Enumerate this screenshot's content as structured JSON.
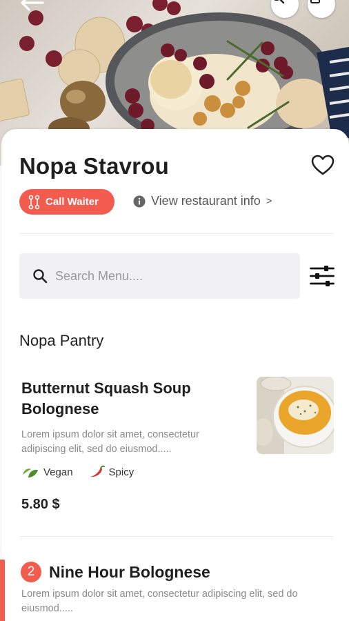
{
  "hero": {
    "image": "food-platter-photo",
    "back_icon": "arrow-left-icon",
    "search_icon": "search-icon",
    "profile_icon": "chef-hat-icon"
  },
  "restaurant": {
    "name": "Nopa Stavrou",
    "favorite_icon": "heart-outline-icon",
    "call_waiter_label": "Call Waiter",
    "info_link_label": "View restaurant info",
    "info_link_chevron": ">"
  },
  "search": {
    "placeholder": "Search Menu....",
    "value": ""
  },
  "menu": {
    "section_title": "Nopa Pantry",
    "items": [
      {
        "name_line1": "Butternut Squash Soup",
        "name_line2": "Bolognese",
        "desc_line1": "Lorem ipsum dolor sit amet, consectetur",
        "desc_line2": "adipiscing elit, sed do eiusmod.....",
        "tags": [
          {
            "icon": "leaf-icon",
            "label": "Vegan"
          },
          {
            "icon": "chili-pepper-icon",
            "label": "Spicy"
          }
        ],
        "price": "5.80 $"
      },
      {
        "count": "2",
        "name": "Nine Hour Bolognese",
        "desc_line1": "Lorem ipsum dolor sit amet, consectetur adipiscing elit, sed do",
        "desc_line2": "eiusmod....."
      }
    ]
  },
  "colors": {
    "accent": "#f25c4f",
    "search_bg": "#f1f1f3",
    "muted_text": "#8a8a8a"
  }
}
